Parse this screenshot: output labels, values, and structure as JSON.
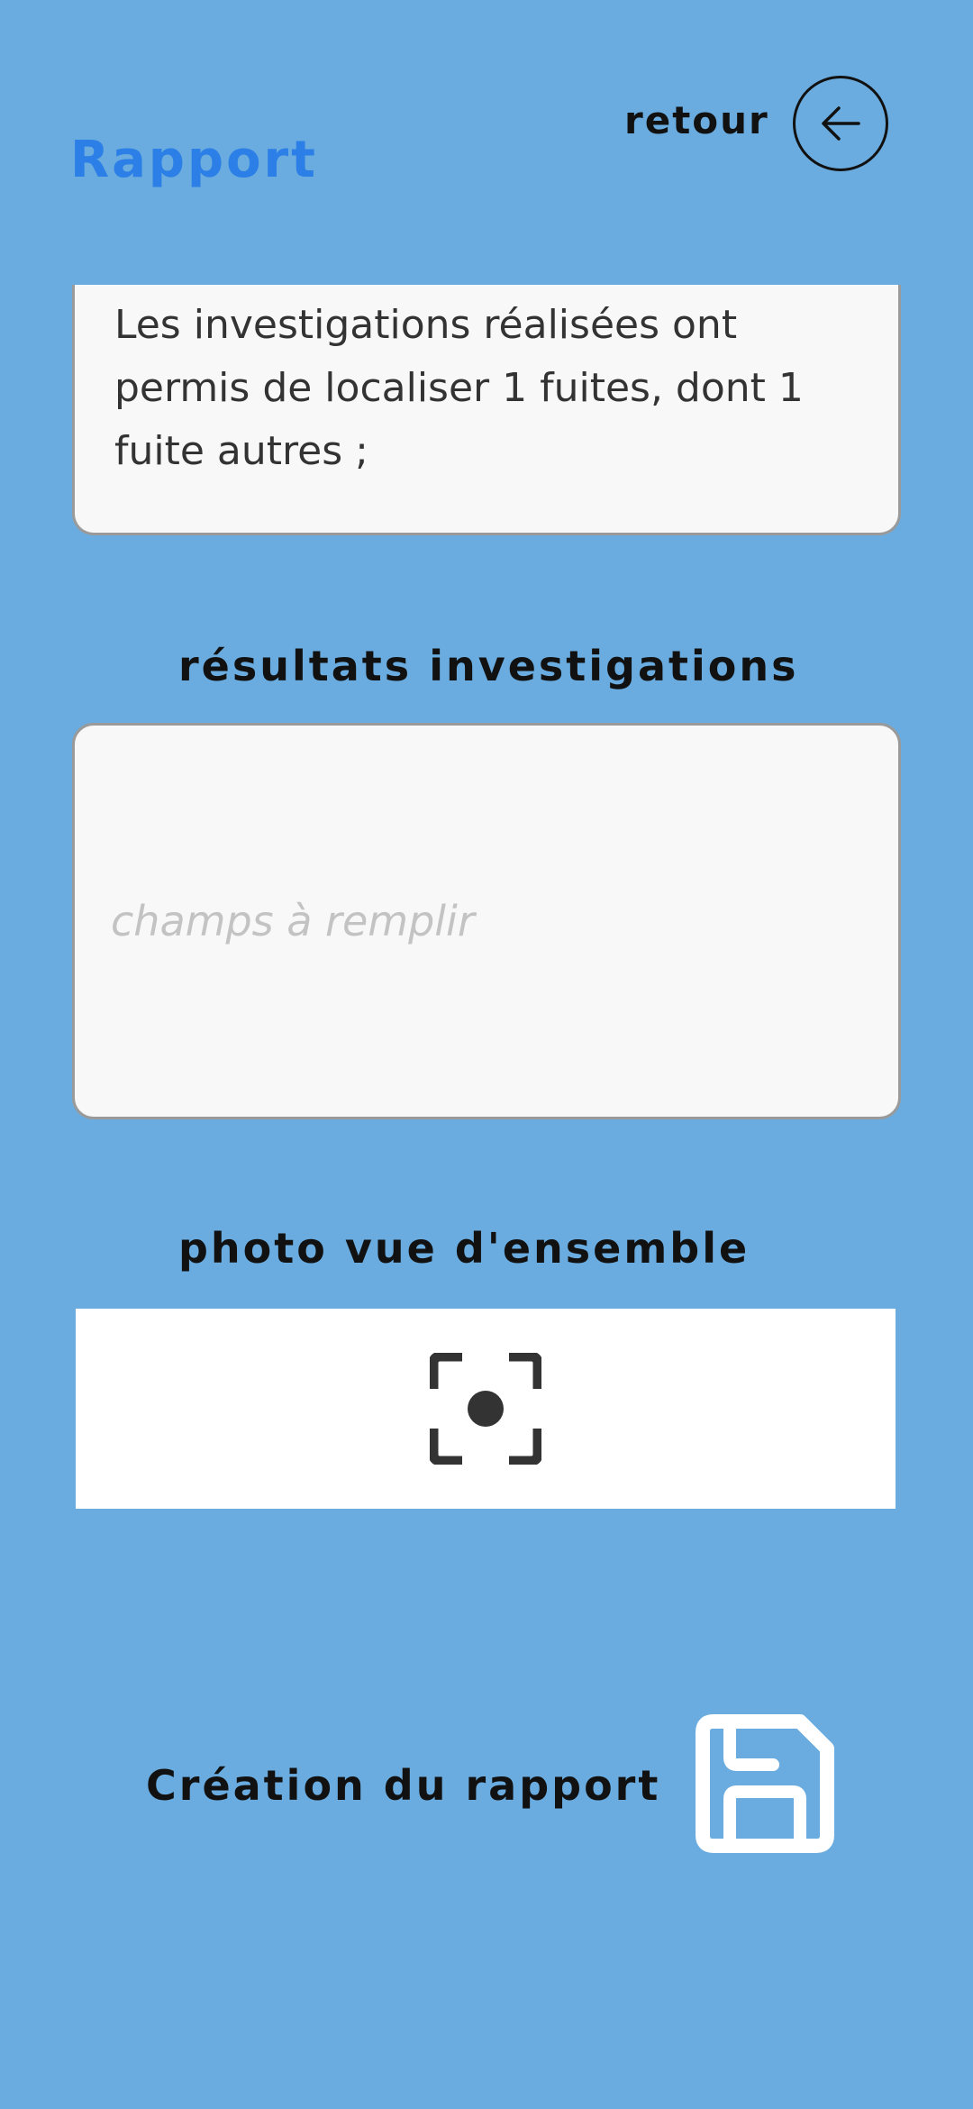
{
  "header": {
    "title": "Rapport",
    "back_label": "retour",
    "back_icon": "arrow-left-icon"
  },
  "summary": {
    "text": "Les investigations réalisées ont permis de localiser 1 fuites, dont 1 fuite autres ;"
  },
  "results": {
    "label": "résultats investigations",
    "value": "",
    "placeholder": "champs à remplir"
  },
  "photo": {
    "label": "photo vue d'ensemble",
    "icon": "camera-focus-icon"
  },
  "footer": {
    "create_label": "Création du rapport",
    "save_icon": "floppy-disk-icon"
  },
  "colors": {
    "background": "#6aacdf",
    "title": "#2b7fe6",
    "card": "#f8f8f8",
    "placeholder": "#c3c3c3"
  }
}
